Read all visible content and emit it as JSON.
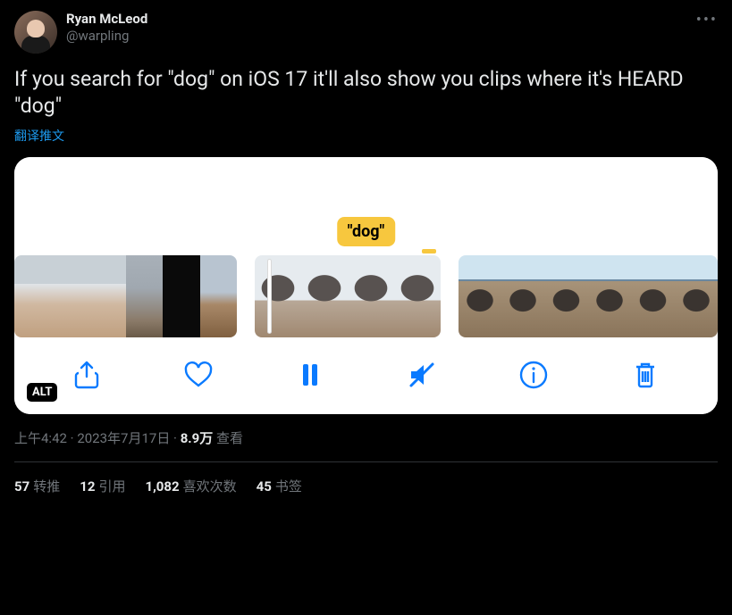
{
  "author": {
    "display_name": "Ryan McLeod",
    "handle": "@warpling"
  },
  "tweet_text": "If you search for \"dog\" on iOS 17 it'll also show you clips where it's HEARD \"dog\"",
  "translate_label": "翻译推文",
  "media": {
    "caption_chip": "\"dog\"",
    "alt_badge": "ALT"
  },
  "meta": {
    "time": "上午4:42",
    "dot1": " · ",
    "date": "2023年7月17日",
    "dot2": " · ",
    "views_count": "8.9万",
    "views_label": " 查看"
  },
  "stats": {
    "retweets_count": "57",
    "retweets_label": "转推",
    "quotes_count": "12",
    "quotes_label": "引用",
    "likes_count": "1,082",
    "likes_label": "喜欢次数",
    "bookmarks_count": "45",
    "bookmarks_label": "书签"
  }
}
